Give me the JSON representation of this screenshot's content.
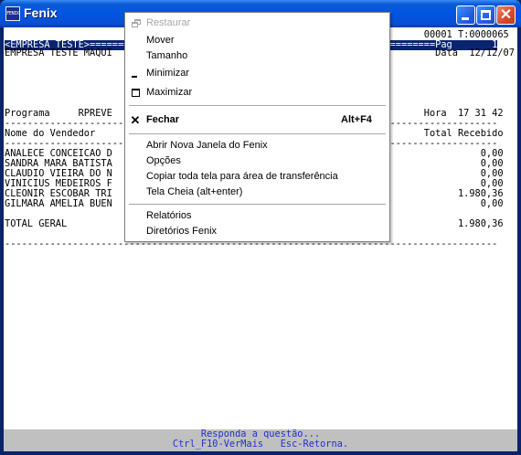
{
  "window": {
    "title": "Fenix",
    "icon_label": "FENIX",
    "controls": {
      "minimize": "minimize",
      "maximize": "maximize",
      "close": "✕"
    }
  },
  "terminal": {
    "lines": [
      {
        "row": 0,
        "text": "                                                                          00001 T:0000065"
      },
      {
        "row": 1,
        "text": "<EMPRESA TESTE>=============================================================Pag       1",
        "highlight": true
      },
      {
        "row": 2,
        "text": "EMPRESA TESTE MAQUI                                                         Data  12/12/07"
      },
      {
        "row": 3,
        "text": ""
      },
      {
        "row": 4,
        "text": ""
      },
      {
        "row": 5,
        "text": ""
      },
      {
        "row": 6,
        "text": ""
      },
      {
        "row": 7,
        "text": "Programa     RPREVE                                                       Hora  17 31 42"
      },
      {
        "row": 8,
        "text": "---------------------------------------------------------------------------------------"
      },
      {
        "row": 9,
        "text": "Nome do Vendedor                                                          Total Recebido"
      },
      {
        "row": 10,
        "text": "---------------------------------------------------------------------------------------"
      },
      {
        "row": 11,
        "text": "ANALECE CONCEICAO D                                                                 0,00"
      },
      {
        "row": 12,
        "text": "SANDRA MARA BATISTA                                                                 0,00"
      },
      {
        "row": 13,
        "text": "CLAUDIO VIEIRA DO N                                                                 0,00"
      },
      {
        "row": 14,
        "text": "VINICIUS MEDEIROS F                                                                 0,00"
      },
      {
        "row": 15,
        "text": "CLEONIR ESCOBAR TRI                                                             1.980,36"
      },
      {
        "row": 16,
        "text": "GILMARA AMELIA BUEN                                                                 0,00"
      },
      {
        "row": 17,
        "text": ""
      },
      {
        "row": 18,
        "text": "TOTAL GERAL                                                                     1.980,36"
      },
      {
        "row": 19,
        "text": ""
      },
      {
        "row": 20,
        "text": "---------------------------------------------------------------------------------------"
      }
    ]
  },
  "statusbar": {
    "line1": "Responda a questão...",
    "line2": "Ctrl_F10-VerMais   Esc-Retorna."
  },
  "menu": {
    "items": [
      {
        "label": "Restaurar",
        "icon": "restore-icon",
        "disabled": true
      },
      {
        "label": "Mover",
        "disabled": false
      },
      {
        "label": "Tamanho",
        "disabled": false
      },
      {
        "label": "Minimizar",
        "icon": "minimize-icon",
        "disabled": false
      },
      {
        "label": "Maximizar",
        "icon": "maximize-icon",
        "disabled": false
      },
      {
        "label": "Fechar",
        "icon": "close-icon",
        "shortcut": "Alt+F4",
        "bold": true
      },
      {
        "label": "Abrir Nova Janela do Fenix"
      },
      {
        "label": "Opções"
      },
      {
        "label": "Copiar toda tela para área de transferência"
      },
      {
        "label": "Tela Cheia (alt+enter)"
      },
      {
        "label": "Relatórios"
      },
      {
        "label": "Diretórios Fenix"
      }
    ]
  }
}
